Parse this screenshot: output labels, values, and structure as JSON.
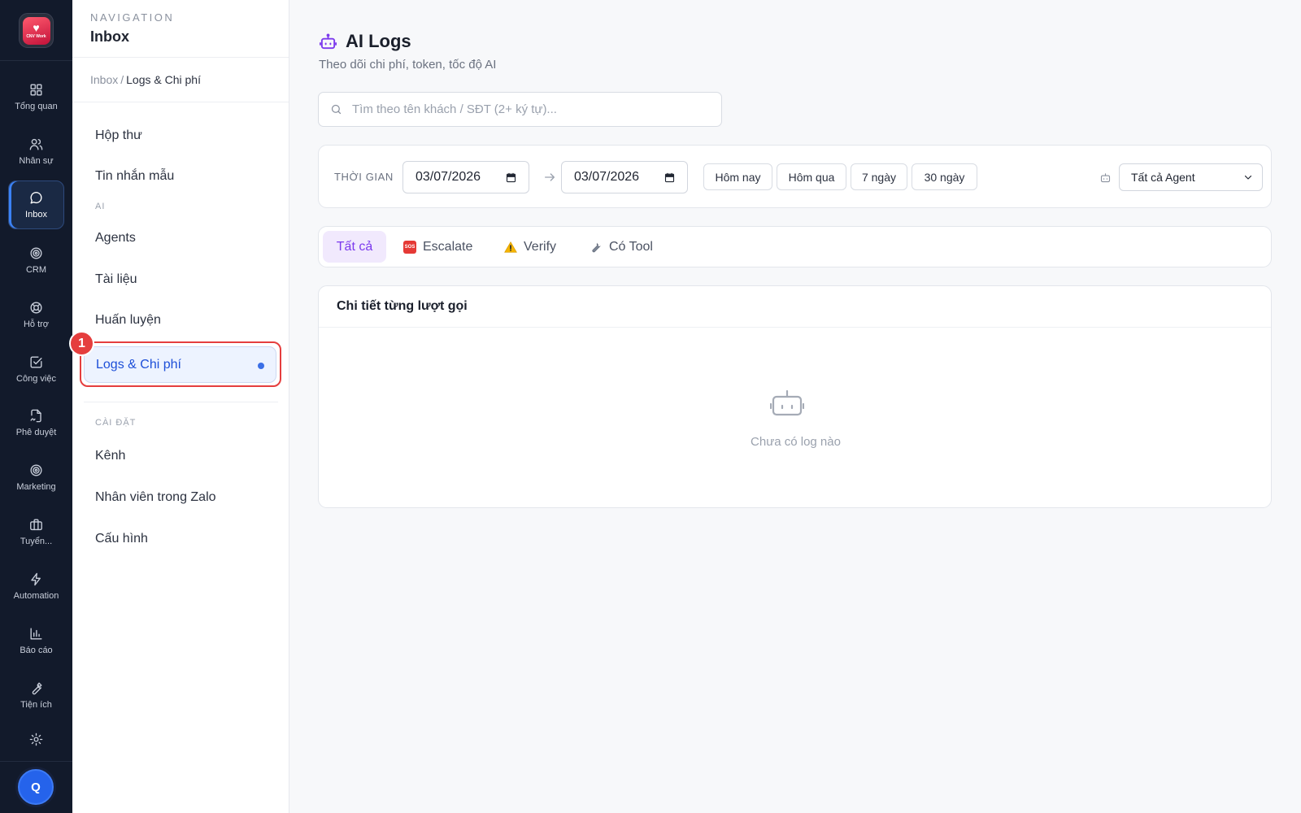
{
  "rail": {
    "logo_text": "CNV Work",
    "items": [
      {
        "label": "Tổng quan",
        "icon": "grid-icon"
      },
      {
        "label": "Nhân sự",
        "icon": "users-icon"
      },
      {
        "label": "Inbox",
        "icon": "message-circle-icon",
        "active": true
      },
      {
        "label": "CRM",
        "icon": "target-icon"
      },
      {
        "label": "Hỗ trợ",
        "icon": "lifebuoy-icon"
      },
      {
        "label": "Công việc",
        "icon": "check-square-icon"
      },
      {
        "label": "Phê duyệt",
        "icon": "file-signature-icon"
      },
      {
        "label": "Marketing",
        "icon": "radar-icon"
      },
      {
        "label": "Tuyển...",
        "icon": "briefcase-icon"
      },
      {
        "label": "Automation",
        "icon": "zap-icon"
      },
      {
        "label": "Báo cáo",
        "icon": "bar-chart-icon"
      },
      {
        "label": "Tiện ích",
        "icon": "wrench-icon"
      }
    ],
    "settings_icon": "gear-icon",
    "avatar_initial": "Q"
  },
  "nav": {
    "eyebrow": "NAVIGATION",
    "title": "Inbox",
    "breadcrumb": {
      "parent": "Inbox",
      "separator": "/",
      "current": "Logs & Chi phí"
    },
    "items": {
      "inbox": "Hộp thư",
      "templates": "Tin nhắn mẫu",
      "agents": "Agents",
      "documents": "Tài liệu",
      "training": "Huấn luyện",
      "logs": "Logs & Chi phí",
      "channels": "Kênh",
      "zalo_staff": "Nhân viên trong Zalo",
      "config": "Cấu hình"
    },
    "sections": {
      "ai": "AI",
      "settings": "CÀI ĐẶT"
    },
    "step_badge": "1",
    "highlight_color": "#e53e3e"
  },
  "main": {
    "title": "AI Logs",
    "title_icon": "bot-icon",
    "subtitle": "Theo dõi chi phí, token, tốc độ AI",
    "search": {
      "placeholder": "Tìm theo tên khách / SĐT (2+ ký tự)...",
      "value": ""
    },
    "filters": {
      "time_label": "THỜI GIAN",
      "date_from": "03/07/2026",
      "date_to": "03/07/2026",
      "presets": [
        "Hôm nay",
        "Hôm qua",
        "7 ngày",
        "30 ngày"
      ],
      "agent_select": "Tất cả Agent"
    },
    "tabs": [
      {
        "label": "Tất cả",
        "active": true
      },
      {
        "label": "Escalate",
        "icon": "sos-icon"
      },
      {
        "label": "Verify",
        "icon": "warning-icon"
      },
      {
        "label": "Có Tool",
        "icon": "wrench-icon"
      }
    ],
    "detail": {
      "title": "Chi tiết từng lượt gọi",
      "empty_text": "Chưa có log nào"
    },
    "accent": "#7c3aed"
  }
}
